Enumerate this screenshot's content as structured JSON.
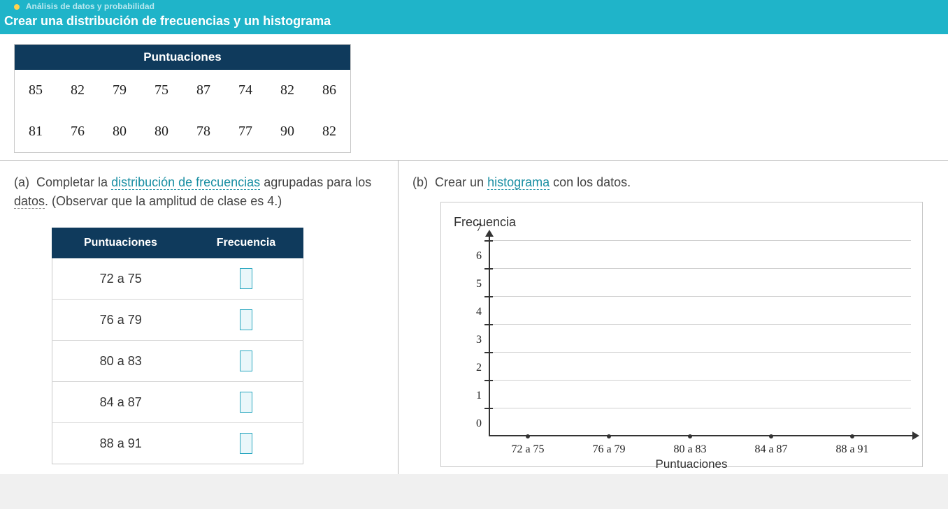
{
  "header": {
    "breadcrumb": "Análisis de datos y probabilidad",
    "title": "Crear una distribución de frecuencias y un histograma"
  },
  "scores": {
    "header": "Puntuaciones",
    "rows": [
      [
        "85",
        "82",
        "79",
        "75",
        "87",
        "74",
        "82",
        "86"
      ],
      [
        "81",
        "76",
        "80",
        "80",
        "78",
        "77",
        "90",
        "82"
      ]
    ]
  },
  "partA": {
    "marker": "(a)",
    "text1": "Completar la ",
    "term1": "distribución de frecuencias",
    "text2": " agrupadas para los ",
    "term2": "datos",
    "text3": ". (Observar que la amplitud de clase es 4.)",
    "table": {
      "col1": "Puntuaciones",
      "col2": "Frecuencia",
      "rows": [
        "72 a 75",
        "76 a 79",
        "80 a 83",
        "84 a 87",
        "88 a 91"
      ]
    }
  },
  "partB": {
    "marker": "(b)",
    "text1": "Crear un ",
    "term1": "histograma",
    "text2": " con los datos."
  },
  "chart_data": {
    "type": "bar",
    "title": "Frecuencia",
    "xlabel": "Puntuaciones",
    "ylabel": "",
    "categories": [
      "72 a 75",
      "76 a 79",
      "80 a 83",
      "84 a 87",
      "88 a 91"
    ],
    "values": [
      null,
      null,
      null,
      null,
      null
    ],
    "y_ticks": [
      0,
      1,
      2,
      3,
      4,
      5,
      6,
      7
    ],
    "ylim": [
      0,
      7
    ]
  }
}
